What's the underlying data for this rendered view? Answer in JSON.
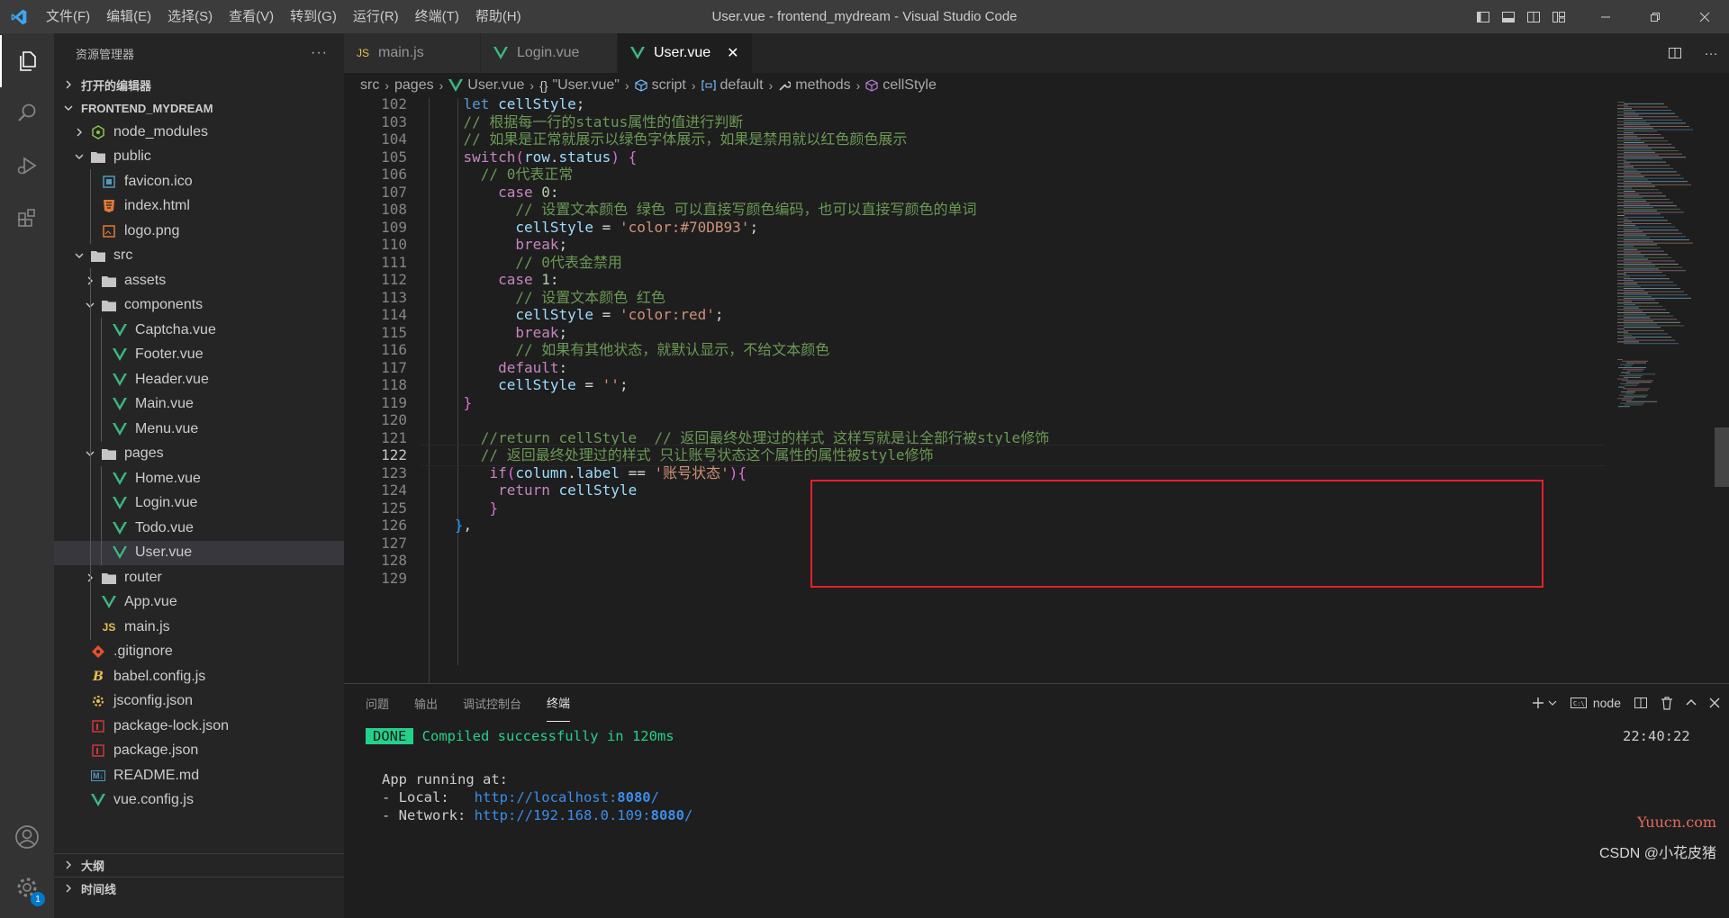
{
  "window": {
    "title": "User.vue - frontend_mydream - Visual Studio Code",
    "menu": [
      "文件(F)",
      "编辑(E)",
      "选择(S)",
      "查看(V)",
      "转到(G)",
      "运行(R)",
      "终端(T)",
      "帮助(H)"
    ]
  },
  "activity": {
    "items": [
      "explorer-icon",
      "search-icon",
      "run-debug-icon",
      "extensions-icon"
    ],
    "bottom": [
      "account-icon",
      "manage-gear-icon"
    ],
    "badge": "1"
  },
  "sidebar": {
    "title": "资源管理器",
    "more": "···",
    "open_editors": "打开的编辑器",
    "project": "FRONTEND_MYDREAM",
    "tree": [
      {
        "label": "node_modules",
        "depth": 1,
        "kind": "folder",
        "open": false,
        "icon": "node"
      },
      {
        "label": "public",
        "depth": 1,
        "kind": "folder",
        "open": true
      },
      {
        "label": "favicon.ico",
        "depth": 2,
        "kind": "file",
        "icon": "ico"
      },
      {
        "label": "index.html",
        "depth": 2,
        "kind": "file",
        "icon": "html"
      },
      {
        "label": "logo.png",
        "depth": 2,
        "kind": "file",
        "icon": "img"
      },
      {
        "label": "src",
        "depth": 1,
        "kind": "folder",
        "open": true
      },
      {
        "label": "assets",
        "depth": 2,
        "kind": "folder",
        "open": false
      },
      {
        "label": "components",
        "depth": 2,
        "kind": "folder",
        "open": true
      },
      {
        "label": "Captcha.vue",
        "depth": 3,
        "kind": "file",
        "icon": "vue"
      },
      {
        "label": "Footer.vue",
        "depth": 3,
        "kind": "file",
        "icon": "vue"
      },
      {
        "label": "Header.vue",
        "depth": 3,
        "kind": "file",
        "icon": "vue"
      },
      {
        "label": "Main.vue",
        "depth": 3,
        "kind": "file",
        "icon": "vue"
      },
      {
        "label": "Menu.vue",
        "depth": 3,
        "kind": "file",
        "icon": "vue"
      },
      {
        "label": "pages",
        "depth": 2,
        "kind": "folder",
        "open": true
      },
      {
        "label": "Home.vue",
        "depth": 3,
        "kind": "file",
        "icon": "vue"
      },
      {
        "label": "Login.vue",
        "depth": 3,
        "kind": "file",
        "icon": "vue"
      },
      {
        "label": "Todo.vue",
        "depth": 3,
        "kind": "file",
        "icon": "vue"
      },
      {
        "label": "User.vue",
        "depth": 3,
        "kind": "file",
        "icon": "vue",
        "selected": true
      },
      {
        "label": "router",
        "depth": 2,
        "kind": "folder",
        "open": false
      },
      {
        "label": "App.vue",
        "depth": 2,
        "kind": "file",
        "icon": "vue"
      },
      {
        "label": "main.js",
        "depth": 2,
        "kind": "file",
        "icon": "js"
      },
      {
        "label": ".gitignore",
        "depth": 1,
        "kind": "file",
        "icon": "git"
      },
      {
        "label": "babel.config.js",
        "depth": 1,
        "kind": "file",
        "icon": "babel"
      },
      {
        "label": "jsconfig.json",
        "depth": 1,
        "kind": "file",
        "icon": "jsconfig"
      },
      {
        "label": "package-lock.json",
        "depth": 1,
        "kind": "file",
        "icon": "npm"
      },
      {
        "label": "package.json",
        "depth": 1,
        "kind": "file",
        "icon": "npm"
      },
      {
        "label": "README.md",
        "depth": 1,
        "kind": "file",
        "icon": "md"
      },
      {
        "label": "vue.config.js",
        "depth": 1,
        "kind": "file",
        "icon": "vue"
      }
    ],
    "outline": "大纲",
    "timeline": "时间线"
  },
  "tabs": [
    {
      "label": "main.js",
      "icon": "js",
      "active": false
    },
    {
      "label": "Login.vue",
      "icon": "vue",
      "active": false
    },
    {
      "label": "User.vue",
      "icon": "vue",
      "active": true
    }
  ],
  "breadcrumb": [
    "src",
    "pages",
    "User.vue",
    "\"User.vue\"",
    "script",
    "default",
    "methods",
    "cellStyle"
  ],
  "code": {
    "current_line": 122,
    "lines": [
      {
        "n": 102,
        "tokens": [
          [
            "    let ",
            "kw2"
          ],
          [
            "cellStyle",
            "var"
          ],
          [
            ";",
            ""
          ]
        ]
      },
      {
        "n": 103,
        "tokens": [
          [
            "    // 根据每一行的status属性的值进行判断",
            "com"
          ]
        ]
      },
      {
        "n": 104,
        "tokens": [
          [
            "    // 如果是正常就展示以绿色字体展示，如果是禁用就以红色颜色展示",
            "com"
          ]
        ]
      },
      {
        "n": 105,
        "tokens": [
          [
            "    ",
            ""
          ],
          [
            "switch",
            "kw"
          ],
          [
            "(",
            "br2"
          ],
          [
            "row",
            "var"
          ],
          [
            ".",
            ""
          ],
          [
            "status",
            "var"
          ],
          [
            ") ",
            "br2"
          ],
          [
            "{",
            "br2"
          ]
        ]
      },
      {
        "n": 106,
        "tokens": [
          [
            "      // 0代表正常",
            "com"
          ]
        ]
      },
      {
        "n": 107,
        "tokens": [
          [
            "        ",
            ""
          ],
          [
            "case ",
            "kw"
          ],
          [
            "0",
            "num"
          ],
          [
            ":",
            ""
          ]
        ]
      },
      {
        "n": 108,
        "tokens": [
          [
            "          // 设置文本颜色 绿色 可以直接写颜色编码，也可以直接写颜色的单词",
            "com"
          ]
        ]
      },
      {
        "n": 109,
        "tokens": [
          [
            "          ",
            ""
          ],
          [
            "cellStyle",
            "var"
          ],
          [
            " = ",
            ""
          ],
          [
            "'color:#70DB93'",
            "str"
          ],
          [
            ";",
            ""
          ]
        ]
      },
      {
        "n": 110,
        "tokens": [
          [
            "          ",
            ""
          ],
          [
            "break",
            "kw"
          ],
          [
            ";",
            ""
          ]
        ]
      },
      {
        "n": 111,
        "tokens": [
          [
            "          // 0代表金禁用",
            "com"
          ]
        ]
      },
      {
        "n": 112,
        "tokens": [
          [
            "        ",
            ""
          ],
          [
            "case ",
            "kw"
          ],
          [
            "1",
            "num"
          ],
          [
            ":",
            ""
          ]
        ]
      },
      {
        "n": 113,
        "tokens": [
          [
            "          // 设置文本颜色 红色",
            "com"
          ]
        ]
      },
      {
        "n": 114,
        "tokens": [
          [
            "          ",
            ""
          ],
          [
            "cellStyle",
            "var"
          ],
          [
            " = ",
            ""
          ],
          [
            "'color:red'",
            "str"
          ],
          [
            ";",
            ""
          ]
        ]
      },
      {
        "n": 115,
        "tokens": [
          [
            "          ",
            ""
          ],
          [
            "break",
            "kw"
          ],
          [
            ";",
            ""
          ]
        ]
      },
      {
        "n": 116,
        "tokens": [
          [
            "          // 如果有其他状态，就默认显示，不给文本颜色",
            "com"
          ]
        ]
      },
      {
        "n": 117,
        "tokens": [
          [
            "        ",
            ""
          ],
          [
            "default",
            "kw"
          ],
          [
            ":",
            ""
          ]
        ]
      },
      {
        "n": 118,
        "tokens": [
          [
            "        ",
            ""
          ],
          [
            "cellStyle",
            "var"
          ],
          [
            " = ",
            ""
          ],
          [
            "''",
            "str"
          ],
          [
            ";",
            ""
          ]
        ]
      },
      {
        "n": 119,
        "tokens": [
          [
            "    ",
            ""
          ],
          [
            "}",
            "br2"
          ]
        ]
      },
      {
        "n": 120,
        "tokens": []
      },
      {
        "n": 121,
        "tokens": [
          [
            "      //return cellStyle  // 返回最终处理过的样式 这样写就是让全部行被style修饰",
            "com"
          ]
        ]
      },
      {
        "n": 122,
        "tokens": [
          [
            "      // 返回最终处理过的样式 只让账号状态这个属性的属性被style修饰",
            "com"
          ]
        ]
      },
      {
        "n": 123,
        "tokens": [
          [
            "       ",
            ""
          ],
          [
            "if",
            "kw"
          ],
          [
            "(",
            "br2"
          ],
          [
            "column",
            "var"
          ],
          [
            ".",
            ""
          ],
          [
            "label",
            "var"
          ],
          [
            " == ",
            ""
          ],
          [
            "'账号状态'",
            "str"
          ],
          [
            ")",
            "br2"
          ],
          [
            "{",
            "br2"
          ]
        ]
      },
      {
        "n": 124,
        "tokens": [
          [
            "        ",
            ""
          ],
          [
            "return ",
            "kw"
          ],
          [
            "cellStyle",
            "var"
          ]
        ]
      },
      {
        "n": 125,
        "tokens": [
          [
            "       ",
            ""
          ],
          [
            "}",
            "br2"
          ]
        ]
      },
      {
        "n": 126,
        "tokens": [
          [
            "   ",
            ""
          ],
          [
            "}",
            "br3"
          ],
          [
            ",",
            ""
          ]
        ]
      },
      {
        "n": 127,
        "tokens": []
      },
      {
        "n": 128,
        "tokens": []
      },
      {
        "n": 129,
        "tokens": []
      }
    ]
  },
  "panel": {
    "tabs": [
      "问题",
      "输出",
      "调试控制台",
      "终端"
    ],
    "active_tab": "终端",
    "shell": "node",
    "terminal": {
      "done_badge": "DONE",
      "compiled": "Compiled successfully in 120ms",
      "time": "22:40:22",
      "app_running": "App running at:",
      "local_label": "- Local:   ",
      "local_url_prefix": "http://localhost:",
      "local_port": "8080",
      "network_label": "- Network: ",
      "network_url_prefix": "http://192.168.0.109:",
      "network_port": "8080",
      "url_suffix": "/"
    }
  },
  "watermark": {
    "site": "Yuucn.com",
    "author": "CSDN @小花皮猪"
  },
  "colors": {
    "accent": "#007acc",
    "vue": "#41b883",
    "js": "#e8c14a",
    "highlight_box": "#e5202a",
    "terminal_green": "#23d18b",
    "terminal_blue": "#3b8eea"
  }
}
